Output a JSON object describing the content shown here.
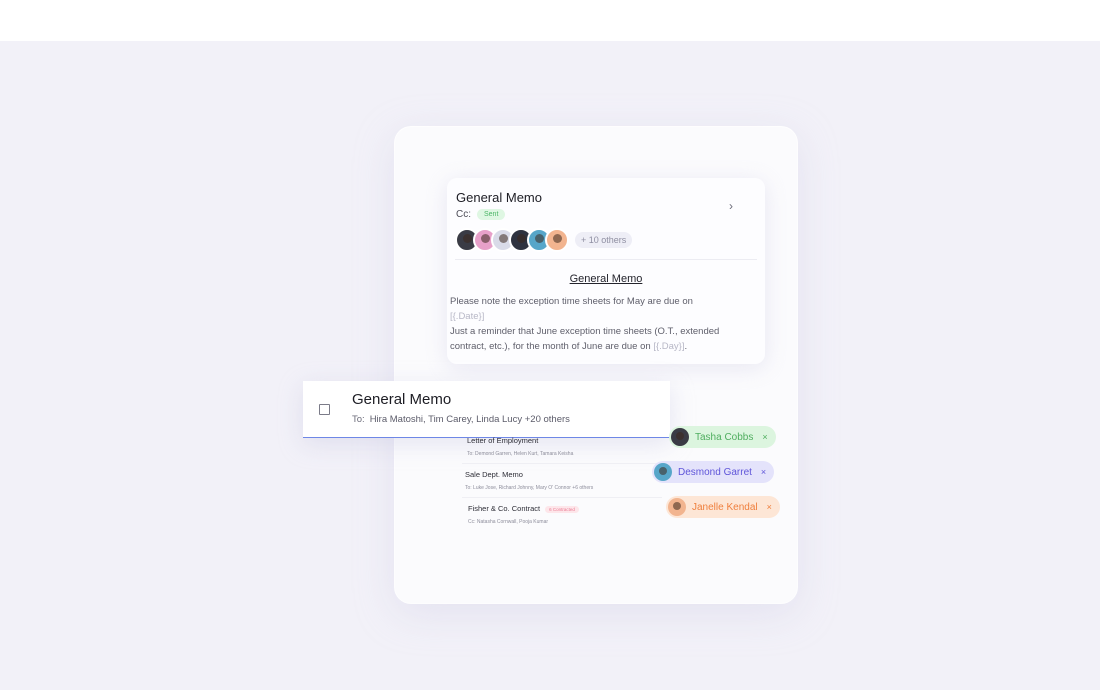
{
  "memo_preview": {
    "title": "General Memo",
    "cc_label": "Cc:",
    "status": "Sent",
    "others": "+ 10 others",
    "avatars": [
      "#3a3b45",
      "#e7a0c9",
      "#d9dbe8",
      "#2f3340",
      "#57a6c9",
      "#f2b48f"
    ],
    "subtitle": "General Memo",
    "body_line1": "Please note the exception time sheets for May are due on",
    "placeholder_date": "[{.Date}]",
    "body_line2": "Just a reminder that June exception time sheets (O.T., extended contract, etc.), for the month of June are due on",
    "placeholder_day": "[{.Day}]"
  },
  "selected_item": {
    "title": "General Memo",
    "to_label": "To:",
    "recipients": "Hira Matoshi, Tim Carey, Linda Lucy +20 others"
  },
  "documents": [
    {
      "title": "Letter of Employment",
      "sub": "To: Demond Garren, Helen Kurt, Tamara Keisha"
    },
    {
      "title": "Sale Dept. Memo",
      "sub": "To: Luke Jose, Richard Johnny, Mary O' Connor +6 others"
    },
    {
      "title": "Fisher & Co. Contract",
      "tag": "6 Contracted",
      "sub": "Cc: Natasha Cornwall, Pooja Kumar"
    }
  ],
  "chips": [
    {
      "name": "Tasha Cobbs",
      "bg": "#dcf5df",
      "color": "#4fae5f",
      "avatar": "#3a3b45"
    },
    {
      "name": "Desmond Garret",
      "bg": "#e4e3fb",
      "color": "#5f55d9",
      "avatar": "#57a6c9"
    },
    {
      "name": "Janelle Kendal",
      "bg": "#fde6d6",
      "color": "#ef7f3d",
      "avatar": "#f2b48f"
    }
  ]
}
